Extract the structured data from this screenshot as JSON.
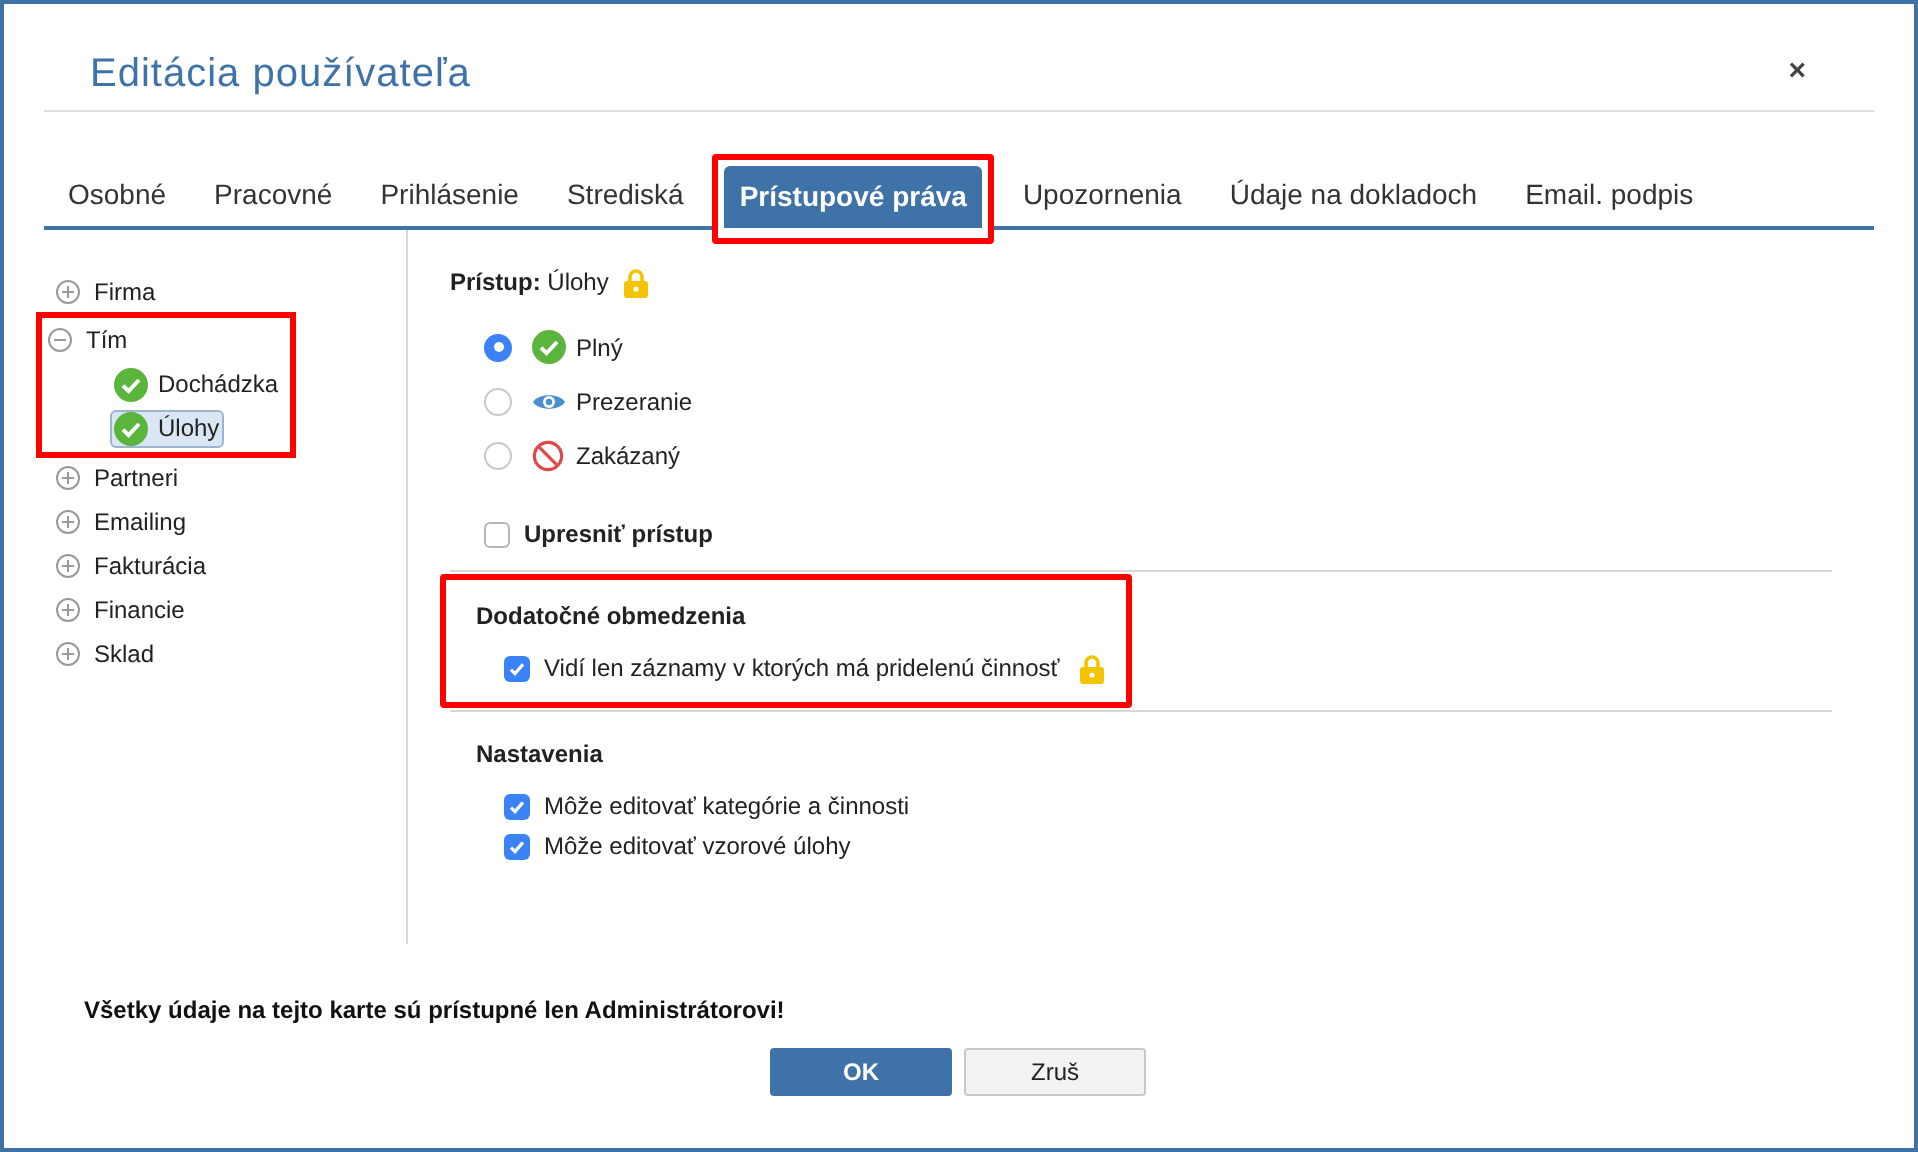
{
  "window": {
    "title": "Editácia používateľa",
    "close": "×"
  },
  "tabs": [
    {
      "label": "Osobné",
      "selected": false,
      "highlighted": false
    },
    {
      "label": "Pracovné",
      "selected": false,
      "highlighted": false
    },
    {
      "label": "Prihlásenie",
      "selected": false,
      "highlighted": false
    },
    {
      "label": "Strediská",
      "selected": false,
      "highlighted": false
    },
    {
      "label": "Prístupové práva",
      "selected": true,
      "highlighted": true
    },
    {
      "label": "Upozornenia",
      "selected": false,
      "highlighted": false
    },
    {
      "label": "Údaje na dokladoch",
      "selected": false,
      "highlighted": false
    },
    {
      "label": "Email. podpis",
      "selected": false,
      "highlighted": false
    }
  ],
  "tree": [
    {
      "label": "Firma",
      "expanded": false,
      "highlighted": false
    },
    {
      "label": "Tím",
      "expanded": true,
      "highlighted": true,
      "children": [
        {
          "label": "Dochádzka",
          "selected": false
        },
        {
          "label": "Úlohy",
          "selected": true
        }
      ]
    },
    {
      "label": "Partneri",
      "expanded": false,
      "highlighted": false
    },
    {
      "label": "Emailing",
      "expanded": false,
      "highlighted": false
    },
    {
      "label": "Fakturácia",
      "expanded": false,
      "highlighted": false
    },
    {
      "label": "Financie",
      "expanded": false,
      "highlighted": false
    },
    {
      "label": "Sklad",
      "expanded": false,
      "highlighted": false
    }
  ],
  "access": {
    "label": "Prístup:",
    "value": "Úlohy",
    "locked": true,
    "options": [
      {
        "kind": "full",
        "label": "Plný",
        "selected": true
      },
      {
        "kind": "view",
        "label": "Prezeranie",
        "selected": false
      },
      {
        "kind": "denied",
        "label": "Zakázaný",
        "selected": false
      }
    ],
    "refine": {
      "label": "Upresniť prístup",
      "checked": false
    }
  },
  "sections": [
    {
      "title": "Dodatočné obmedzenia",
      "highlighted": true,
      "items": [
        {
          "label": "Vidí len záznamy v ktorých má pridelenú činnosť",
          "checked": true,
          "locked": true
        }
      ]
    },
    {
      "title": "Nastavenia",
      "highlighted": false,
      "items": [
        {
          "label": "Môže editovať kategórie a činnosti",
          "checked": true,
          "locked": false
        },
        {
          "label": "Môže editovať vzorové úlohy",
          "checked": true,
          "locked": false
        }
      ]
    }
  ],
  "notice": "Všetky údaje na tejto karte sú prístupné len Administrátorovi!",
  "buttons": [
    {
      "label": "OK",
      "kind": "primary"
    },
    {
      "label": "Zruš",
      "kind": "secondary"
    }
  ]
}
